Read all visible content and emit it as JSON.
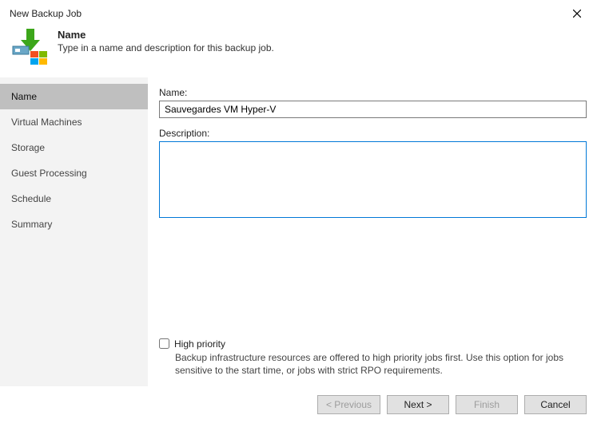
{
  "window": {
    "title": "New Backup Job"
  },
  "header": {
    "title": "Name",
    "subtitle": "Type in a name and description for this backup job."
  },
  "sidebar": {
    "items": [
      {
        "label": "Name",
        "active": true
      },
      {
        "label": "Virtual Machines",
        "active": false
      },
      {
        "label": "Storage",
        "active": false
      },
      {
        "label": "Guest Processing",
        "active": false
      },
      {
        "label": "Schedule",
        "active": false
      },
      {
        "label": "Summary",
        "active": false
      }
    ]
  },
  "form": {
    "name_label": "Name:",
    "name_value": "Sauvegardes VM Hyper-V",
    "description_label": "Description:",
    "description_value": "",
    "high_priority_label": "High priority",
    "high_priority_checked": false,
    "high_priority_hint": "Backup infrastructure resources are offered to high priority jobs first. Use this option for jobs sensitive to the start time, or jobs with strict RPO requirements."
  },
  "buttons": {
    "previous": "< Previous",
    "next": "Next >",
    "finish": "Finish",
    "cancel": "Cancel"
  }
}
